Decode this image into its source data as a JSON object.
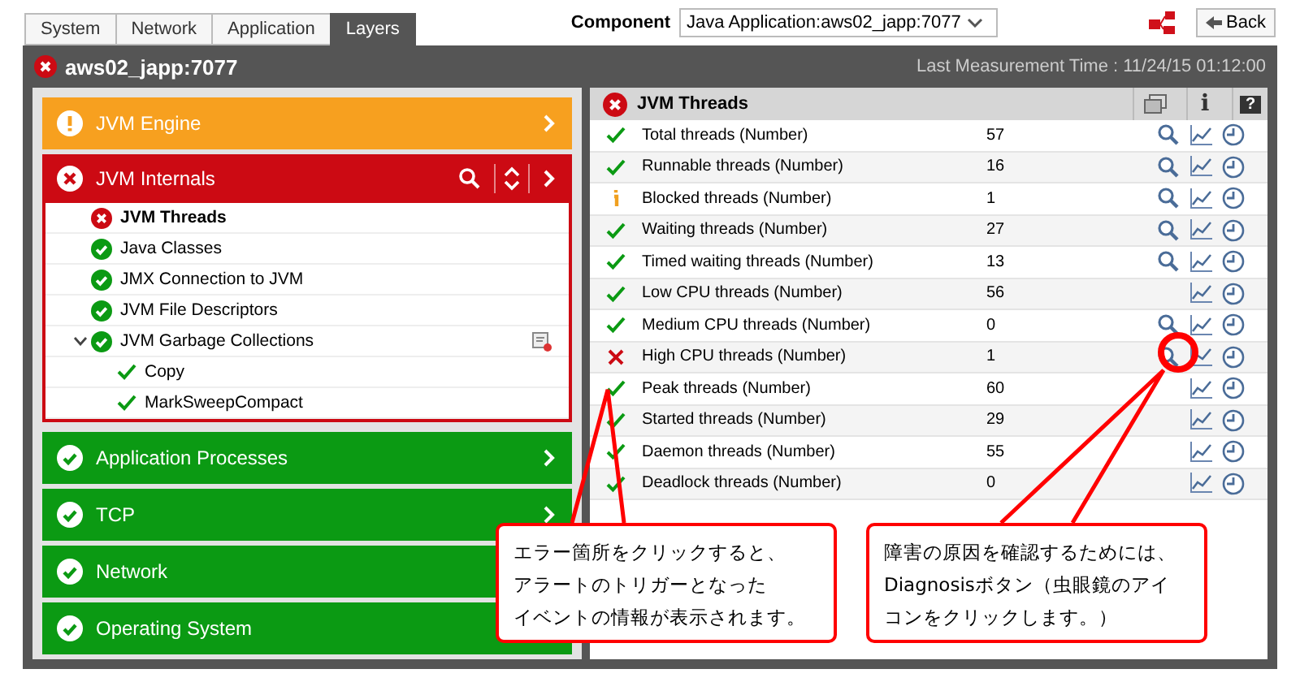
{
  "tabs": [
    {
      "label": "System",
      "selected": false
    },
    {
      "label": "Network",
      "selected": false
    },
    {
      "label": "Application",
      "selected": false
    },
    {
      "label": "Layers",
      "selected": true
    }
  ],
  "component": {
    "label": "Component",
    "value": "Java Application:aws02_japp:7077"
  },
  "back_button": "Back",
  "server": {
    "name": "aws02_japp:7077",
    "kind": "error"
  },
  "last_measurement": "Last Measurement Time : 11/24/15 01:12:00",
  "layers": [
    {
      "name": "JVM Engine",
      "kind": "warning",
      "expanded": false
    },
    {
      "name": "JVM Internals",
      "kind": "error",
      "expanded": true,
      "children": [
        {
          "name": "JVM Threads",
          "kind": "error",
          "selected": true
        },
        {
          "name": "Java Classes",
          "kind": "ok",
          "selected": false
        },
        {
          "name": "JMX Connection to JVM",
          "kind": "ok",
          "selected": false
        },
        {
          "name": "JVM File Descriptors",
          "kind": "ok",
          "selected": false
        },
        {
          "name": "JVM Garbage Collections",
          "kind": "ok",
          "selected": false,
          "expanded": true,
          "config": true,
          "children": [
            {
              "name": "Copy",
              "kind": "ok",
              "selected": false
            },
            {
              "name": "MarkSweepCompact",
              "kind": "ok",
              "selected": false
            }
          ]
        }
      ]
    },
    {
      "name": "Application Processes",
      "kind": "ok",
      "expanded": false
    },
    {
      "name": "TCP",
      "kind": "ok",
      "expanded": false
    },
    {
      "name": "Network",
      "kind": "ok",
      "expanded": false
    },
    {
      "name": "Operating System",
      "kind": "ok",
      "expanded": false
    }
  ],
  "test": {
    "title": "JVM Threads",
    "kind": "error",
    "tools": [
      {
        "kind": "windows"
      },
      {
        "kind": "info",
        "label": "i"
      },
      {
        "kind": "help",
        "label": "?"
      }
    ]
  },
  "measures": [
    {
      "name": "Total threads (Number)",
      "value": "57",
      "kind": "ok",
      "diagnosis": true
    },
    {
      "name": "Runnable threads (Number)",
      "value": "16",
      "kind": "ok",
      "diagnosis": true
    },
    {
      "name": "Blocked threads (Number)",
      "value": "1",
      "kind": "info",
      "diagnosis": true
    },
    {
      "name": "Waiting threads (Number)",
      "value": "27",
      "kind": "ok",
      "diagnosis": true
    },
    {
      "name": "Timed waiting threads (Number)",
      "value": "13",
      "kind": "ok",
      "diagnosis": true
    },
    {
      "name": "Low CPU threads (Number)",
      "value": "56",
      "kind": "ok",
      "diagnosis": false
    },
    {
      "name": "Medium CPU threads (Number)",
      "value": "0",
      "kind": "ok",
      "diagnosis": true
    },
    {
      "name": "High CPU threads (Number)",
      "value": "1",
      "kind": "error",
      "diagnosis": true
    },
    {
      "name": "Peak threads (Number)",
      "value": "60",
      "kind": "ok",
      "diagnosis": false
    },
    {
      "name": "Started threads (Number)",
      "value": "29",
      "kind": "ok",
      "diagnosis": false
    },
    {
      "name": "Daemon threads (Number)",
      "value": "55",
      "kind": "ok",
      "diagnosis": false
    },
    {
      "name": "Deadlock threads (Number)",
      "value": "0",
      "kind": "ok",
      "diagnosis": false
    }
  ],
  "callouts": [
    {
      "lines": [
        "エラー箇所をクリックすると、",
        "アラートのトリガーとなった",
        "イベントの情報が表示されます。"
      ]
    },
    {
      "lines": [
        "障害の原因を確認するためには、",
        "Diagnosisボタン（虫眼鏡のアイ",
        "コンをクリックします。）"
      ]
    }
  ]
}
